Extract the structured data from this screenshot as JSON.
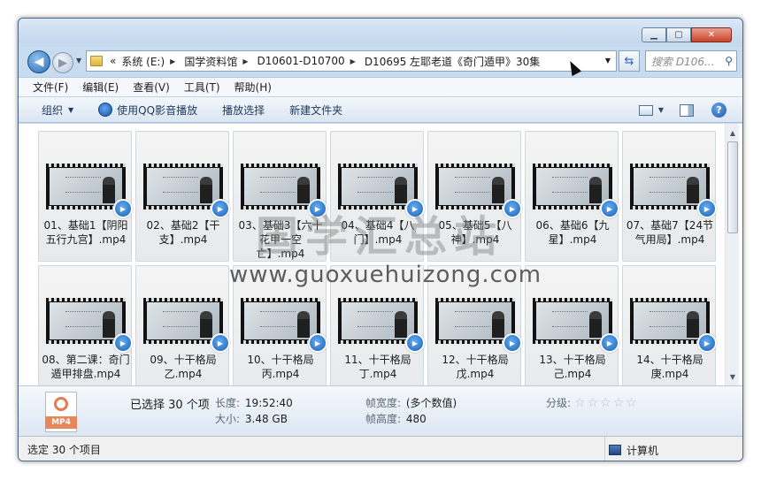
{
  "address_bar": {
    "segments": [
      "系统 (E:)",
      "国学资料馆",
      "D10601-D10700",
      "D10695 左耶老道《奇门遁甲》30集"
    ],
    "leading": "«"
  },
  "search": {
    "placeholder": "搜索 D106..."
  },
  "menu": [
    "文件(F)",
    "编辑(E)",
    "查看(V)",
    "工具(T)",
    "帮助(H)"
  ],
  "toolbar": {
    "organize": "组织",
    "play_with_qq": "使用QQ影音播放",
    "play_selection": "播放选择",
    "new_folder": "新建文件夹"
  },
  "files": [
    "01、基础1【阴阳五行九宫】.mp4",
    "02、基础2【干支】.mp4",
    "03、基础3【六十花甲一空亡】.mp4",
    "04、基础4【八门】.mp4",
    "05、基础5【八神】.mp4",
    "06、基础6【九星】.mp4",
    "07、基础7【24节气用局】.mp4",
    "08、第二课：奇门遁甲排盘.mp4",
    "09、十干格局乙.mp4",
    "10、十干格局丙.mp4",
    "11、十干格局丁.mp4",
    "12、十干格局戊.mp4",
    "13、十干格局己.mp4",
    "14、十干格局庚.mp4"
  ],
  "watermark": {
    "cn": "国学汇总站",
    "en": "www.guoxuehuizong.com"
  },
  "details": {
    "file_icon_label": "MP4",
    "selected": "已选择 30 个项",
    "length_key": "长度:",
    "length_val": "19:52:40",
    "size_key": "大小:",
    "size_val": "3.48 GB",
    "width_key": "帧宽度:",
    "width_val": "(多个数值)",
    "height_key": "帧高度:",
    "height_val": "480",
    "rating_key": "分级:",
    "rating_value": 0,
    "rating_max": 5
  },
  "status": {
    "left": "选定 30 个项目",
    "right": "计算机"
  }
}
